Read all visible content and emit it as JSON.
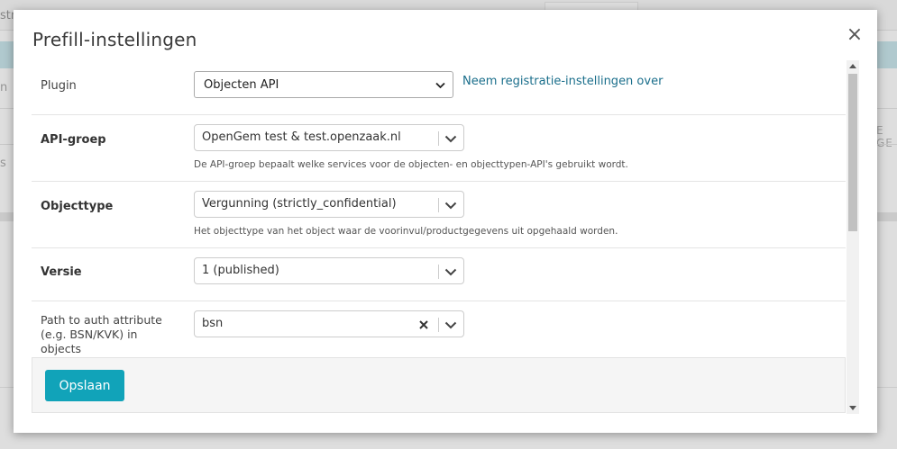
{
  "background": {
    "topbar_text": "str",
    "left_fragment_1": "n",
    "left_fragment_2": "s",
    "right_fragment": "E GE"
  },
  "modal": {
    "title": "Prefill-instellingen",
    "close_label": "×"
  },
  "form": {
    "plugin": {
      "label": "Plugin",
      "value": "Objecten API",
      "link_text": "Neem registratie-instellingen over"
    },
    "api_group": {
      "label": "API-groep",
      "value": "OpenGem test & test.openzaak.nl",
      "help": "De API-groep bepaalt welke services voor de objecten- en objecttypen-API's gebruikt wordt."
    },
    "objecttype": {
      "label": "Objecttype",
      "value": "Vergunning (strictly_confidential)",
      "help": "Het objecttype van het object waar de voorinvul/productgegevens uit opgehaald worden."
    },
    "version": {
      "label": "Versie",
      "value": "1 (published)"
    },
    "auth_path": {
      "label_line1": "Path to auth attribute",
      "label_line2": "(e.g. BSN/KVK) in",
      "label_line3": "objects",
      "value": "bsn"
    }
  },
  "footer": {
    "save_label": "Opslaan"
  },
  "colors": {
    "primary_button": "#11a3b9",
    "link": "#1a6e8b",
    "accent_band": "#cbe7ed"
  },
  "icons": {
    "close": "close-icon",
    "dropdown": "chevron-down-icon",
    "clear": "clear-icon"
  }
}
